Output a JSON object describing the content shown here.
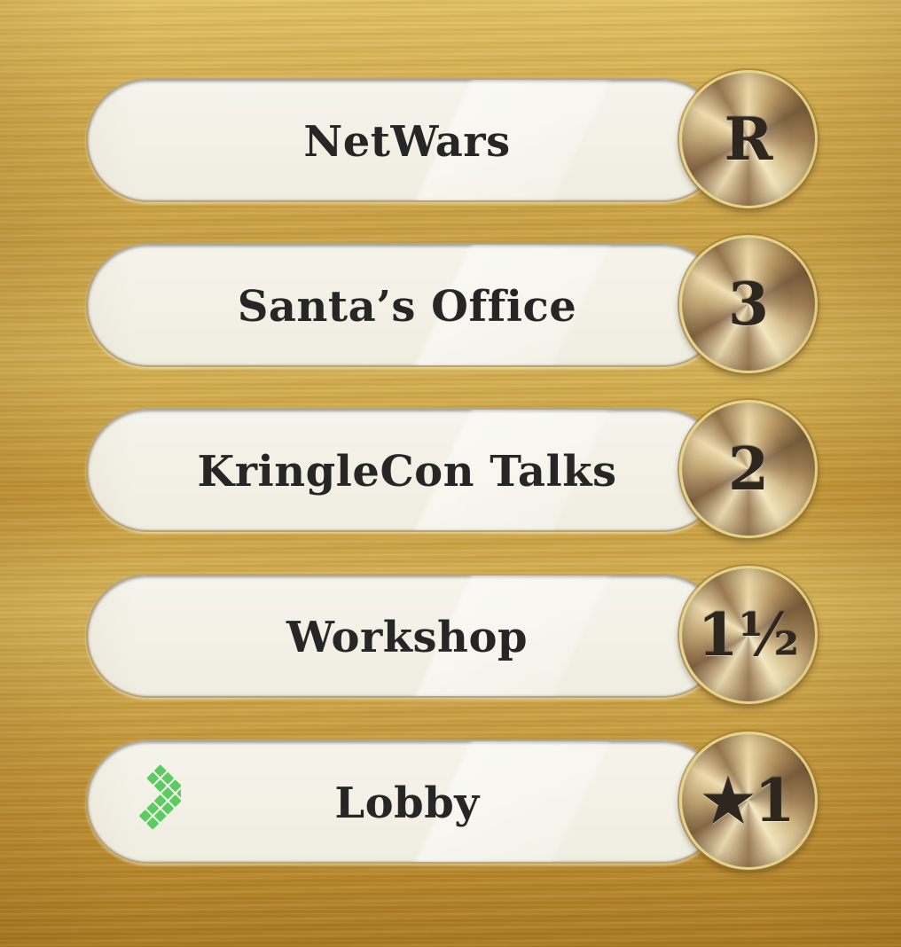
{
  "floors": [
    {
      "label": "NetWars",
      "knob": "R"
    },
    {
      "label": "Santa’s Office",
      "knob": "3"
    },
    {
      "label": "KringleCon Talks",
      "knob": "2"
    },
    {
      "label": "Workshop",
      "knob": "1½"
    },
    {
      "label": "Lobby",
      "knob": "★1"
    }
  ],
  "icons": {
    "exit": "green-arrow-icon"
  },
  "colors": {
    "panel": "#c9a042",
    "button_face": "#f3f1e6",
    "label_text": "#262626",
    "knob_rim": "#e5d489",
    "exit_icon": "#5ccc62"
  }
}
